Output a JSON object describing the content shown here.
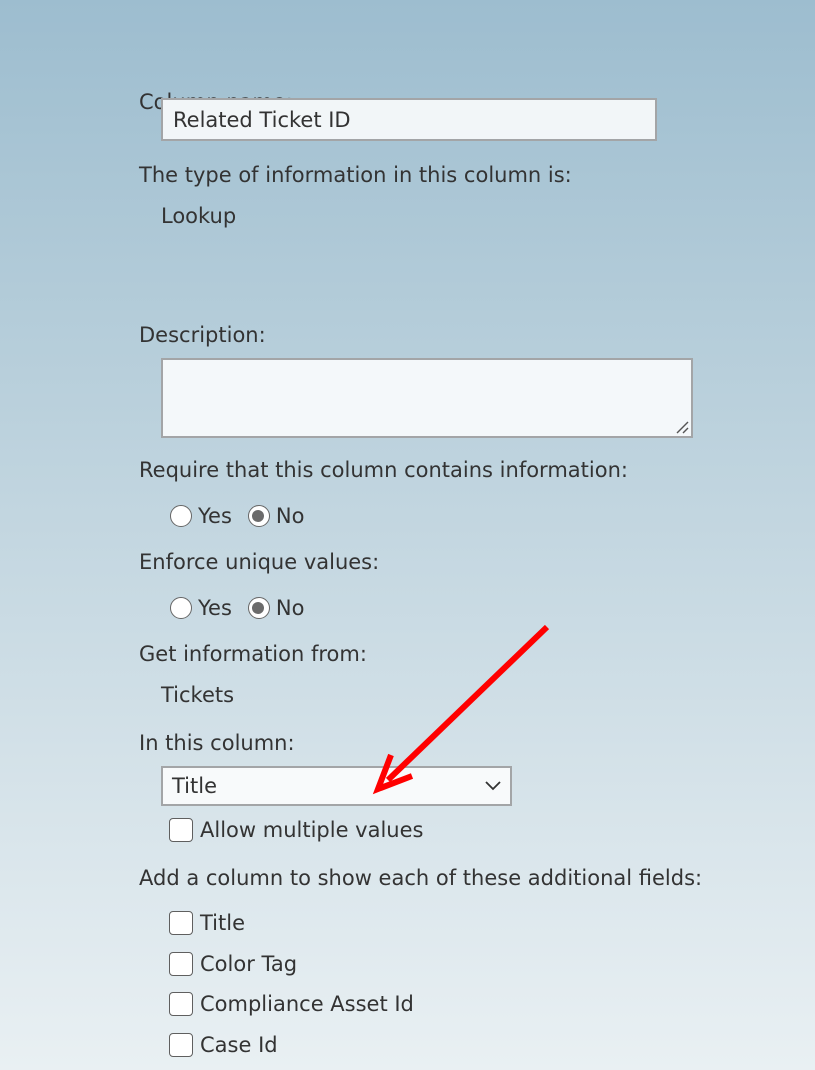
{
  "form": {
    "column_name": {
      "label": "Column name:",
      "value": "Related Ticket ID"
    },
    "type_info": {
      "label": "The type of information in this column is:",
      "value": "Lookup"
    },
    "description": {
      "label": "Description:",
      "value": ""
    },
    "require": {
      "label": "Require that this column contains information:",
      "options": [
        {
          "label": "Yes",
          "checked": false
        },
        {
          "label": "No",
          "checked": true
        }
      ]
    },
    "unique": {
      "label": "Enforce unique values:",
      "options": [
        {
          "label": "Yes",
          "checked": false
        },
        {
          "label": "No",
          "checked": true
        }
      ]
    },
    "source": {
      "label": "Get information from:",
      "value": "Tickets"
    },
    "in_column": {
      "label": "In this column:",
      "selected": "Title"
    },
    "allow_multiple": {
      "label": "Allow multiple values",
      "checked": false
    },
    "additional_fields": {
      "label": "Add a column to show each of these additional fields:",
      "items": [
        {
          "label": "Title",
          "checked": false
        },
        {
          "label": "Color Tag",
          "checked": false
        },
        {
          "label": "Compliance Asset Id",
          "checked": false
        },
        {
          "label": "Case Id",
          "checked": false
        }
      ]
    }
  },
  "annotation": {
    "type": "arrow",
    "color": "#ff0000",
    "points_to": "in-this-column-select"
  },
  "colors": {
    "background_top": "#9dbdcf",
    "background_bottom": "#e9f0f3",
    "text": "#333333",
    "input_border": "#a3a5a7"
  }
}
